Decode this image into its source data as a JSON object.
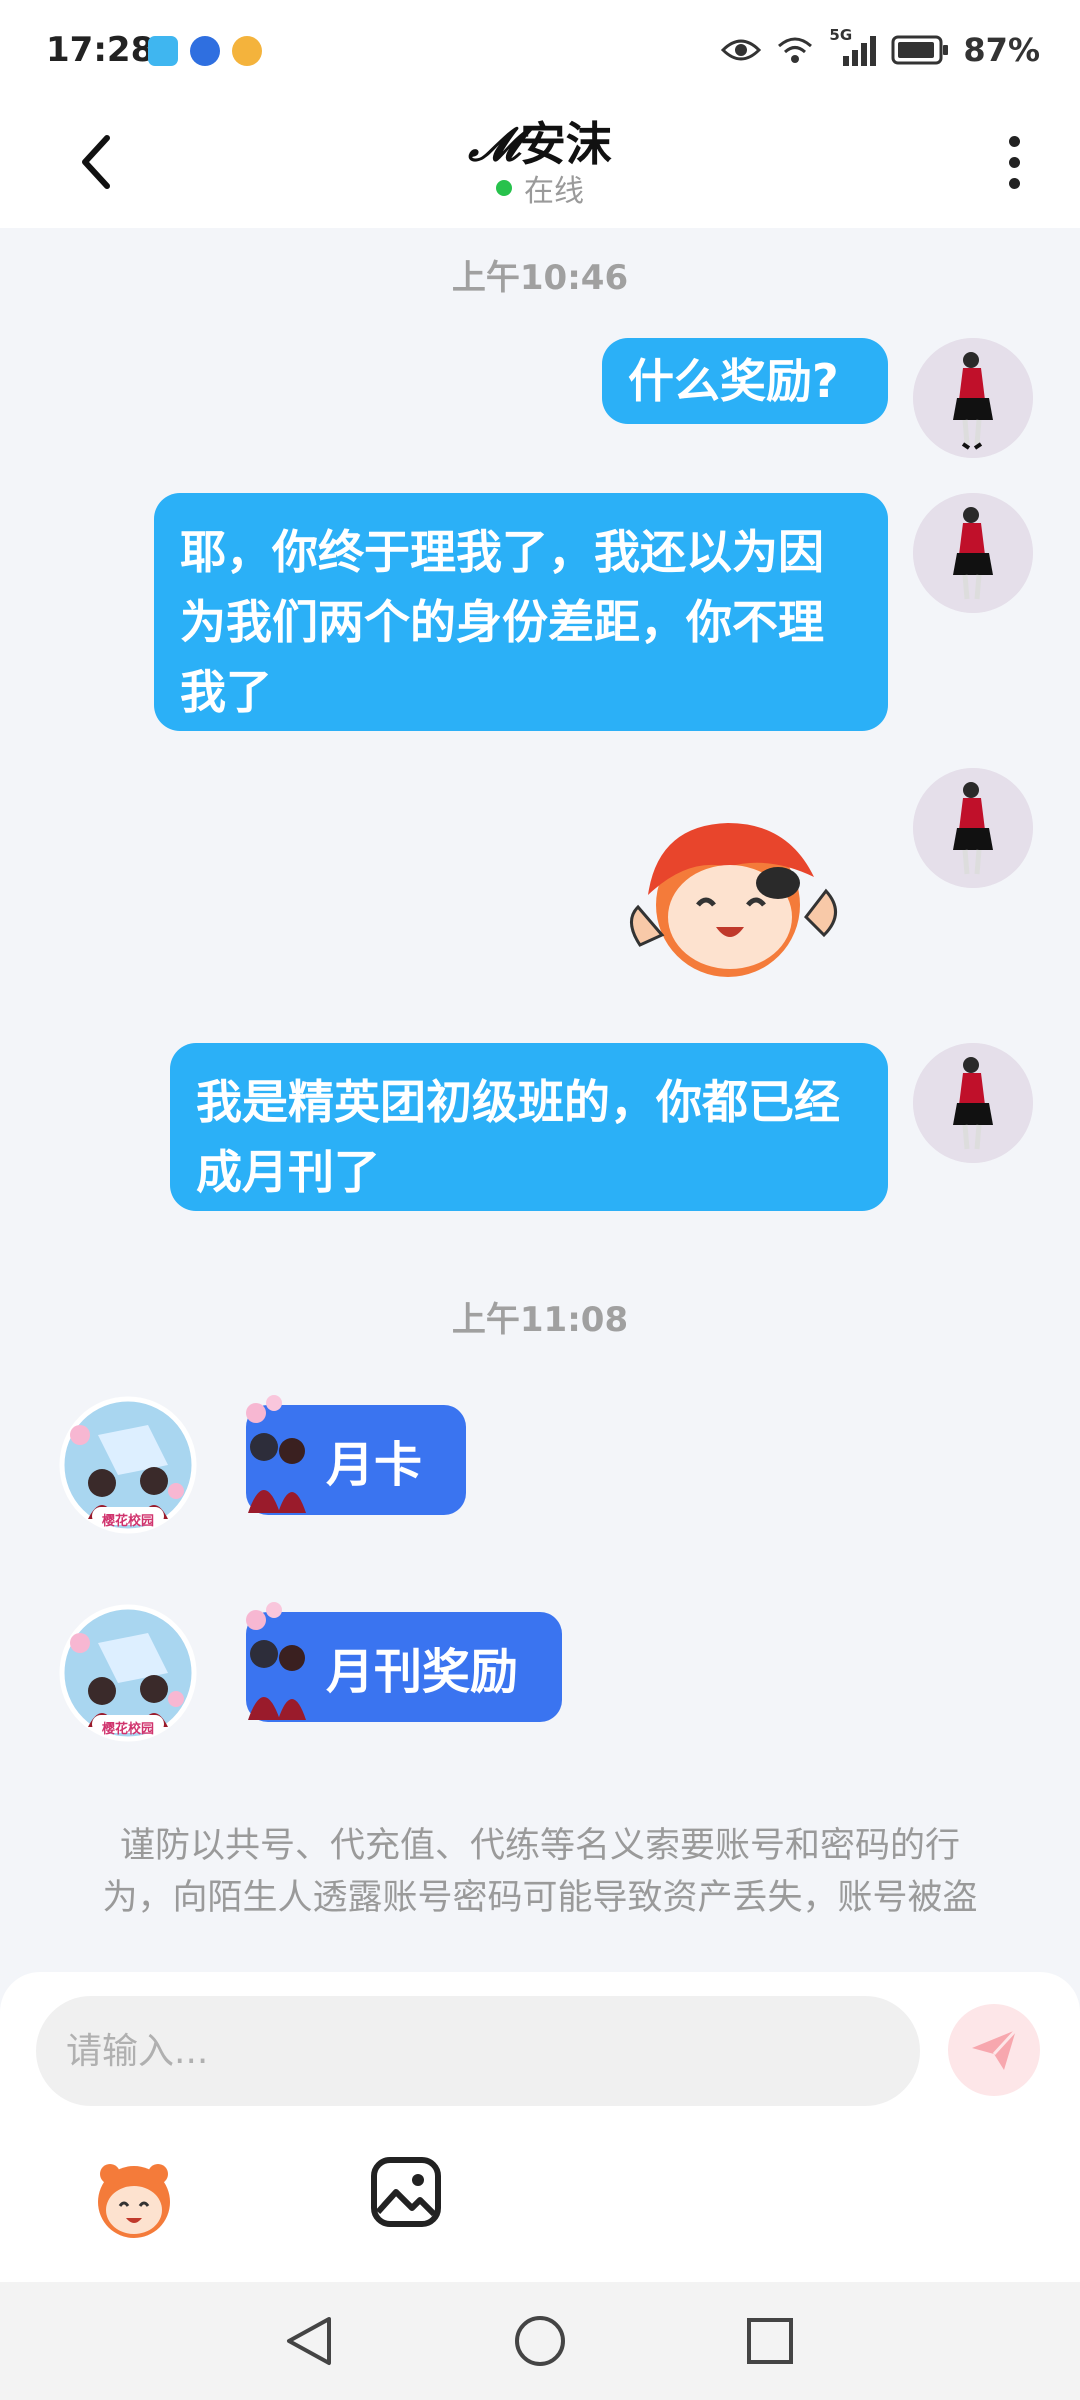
{
  "status_bar": {
    "time": "17:28",
    "network": "5G",
    "battery": "87%"
  },
  "header": {
    "title_script": "𝓜",
    "title_name": "安沫",
    "status": "在线"
  },
  "chat": {
    "timestamps": [
      "上午10:46",
      "上午11:08"
    ],
    "sent_messages": [
      "什么奖励?",
      "耶，你终于理我了，我还以为因为我们两个的身份差距，你不理我了",
      "我是精英团初级班的，你都已经成月刊了"
    ],
    "received_messages": [
      "月卡",
      "月刊奖励"
    ],
    "avatar_badge": "樱花校园"
  },
  "notice": {
    "line1": "谨防以共号、代充值、代练等名义索要账号和密码的行",
    "line2": "为，向陌生人透露账号密码可能导致资产丢失，账号被盗"
  },
  "input": {
    "placeholder": "请输入..."
  },
  "colors": {
    "sent_bubble": "#2bb0f7",
    "received_bubble": "#3a74f0",
    "online": "#27c24c",
    "send_button_bg": "#fde6e8",
    "send_icon": "#f7a7ae"
  }
}
